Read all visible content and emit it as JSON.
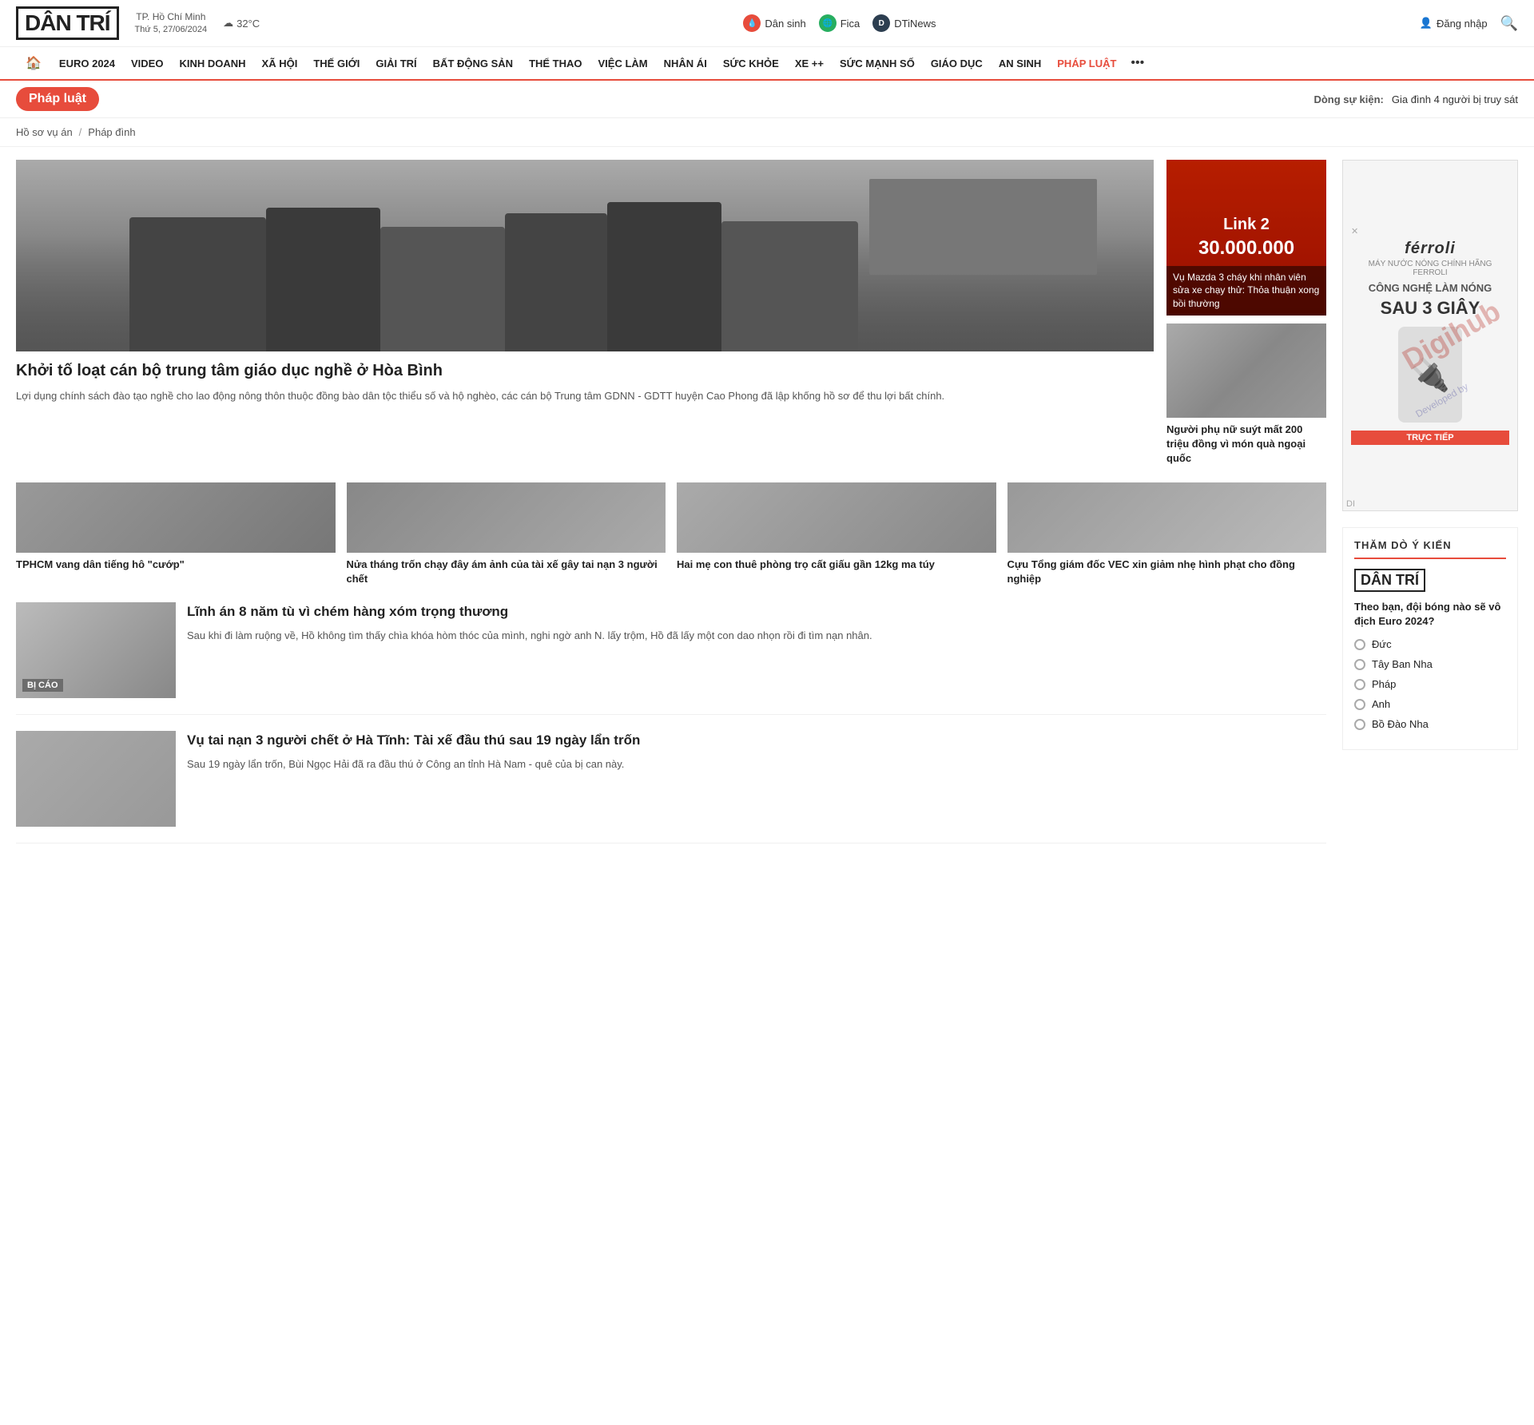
{
  "header": {
    "logo": "DÂN TRÍ",
    "location": "TP. Hồ Chí Minh",
    "date": "Thứ 5, 27/06/2024",
    "weather_icon": "☁",
    "temperature": "32°C",
    "channels": [
      {
        "id": "dan-sinh",
        "label": "Dân sinh",
        "icon": "💧",
        "icon_class": "channel-dan-sinh"
      },
      {
        "id": "fica",
        "label": "Fica",
        "icon": "🌐",
        "icon_class": "channel-fica"
      },
      {
        "id": "dtinews",
        "label": "DTiNews",
        "icon": "D",
        "icon_class": "channel-dtinews"
      }
    ],
    "login_label": "Đăng nhập",
    "search_icon": "🔍"
  },
  "nav": {
    "home_icon": "🏠",
    "items": [
      "EURO 2024",
      "VIDEO",
      "KINH DOANH",
      "XÃ HỘI",
      "THẾ GIỚI",
      "GIẢI TRÍ",
      "BẤT ĐỘNG SẢN",
      "THỂ THAO",
      "VIỆC LÀM",
      "NHÂN ÁI",
      "SỨC KHỎE",
      "XE ++",
      "SỨC MẠNH SỐ",
      "GIÁO DỤC",
      "AN SINH",
      "PHÁP LUẬT"
    ],
    "more_icon": "•••"
  },
  "category": {
    "label": "Pháp luật",
    "breaking_label": "Dòng sự kiện:",
    "breaking_text": "Gia đình 4 người bị truy sát"
  },
  "breadcrumb": {
    "items": [
      "Hồ sơ vụ án",
      "Pháp đình"
    ],
    "separator": "/"
  },
  "featured": {
    "main": {
      "title": "Khởi tố loạt cán bộ trung tâm giáo dục nghề ở Hòa Bình",
      "desc": "Lợi dụng chính sách đào tạo nghề cho lao động nông thôn thuộc đồng bào dân tộc thiểu số và hộ nghèo, các cán bộ Trung tâm GDNN - GDTT huyện Cao Phong đã lập khống hồ sơ để thu lợi bất chính."
    },
    "side_top": {
      "link_label": "Link 2",
      "amount": "30.000.000",
      "caption": "Vụ Mazda 3 cháy khi nhân viên sửa xe chạy thử: Thỏa thuận xong bồi thường"
    },
    "side_bottom": {
      "caption": "Người phụ nữ suýt mất 200 triệu đồng vì món quà ngoại quốc"
    }
  },
  "small_articles": [
    {
      "title": "TPHCM vang dân tiếng hô \"cướp\""
    },
    {
      "title": "Nửa tháng trốn chạy đây ám ảnh của tài xế gây tai nạn 3 người chết"
    },
    {
      "title": "Hai mẹ con thuê phòng trọ cất giấu gần 12kg ma túy"
    },
    {
      "title": "Cựu Tổng giám đốc VEC xin giảm nhẹ hình phạt cho đồng nghiệp"
    }
  ],
  "articles": [
    {
      "title": "Lĩnh án 8 năm tù vì chém hàng xóm trọng thương",
      "desc": "Sau khi đi làm ruộng về, Hồ không tìm thấy chìa khóa hòm thóc của mình, nghi ngờ anh N. lấy trộm, Hồ đã lấy một con dao nhọn rồi đi tìm nạn nhân.",
      "tag": "BỊ CÁO"
    },
    {
      "title": "Vụ tai nạn 3 người chết ở Hà Tĩnh: Tài xế đầu thú sau 19 ngày lẩn trốn",
      "desc": "Sau 19 ngày lẩn trốn, Bùi Ngọc Hải đã ra đầu thú ở Công an tỉnh Hà Nam - quê của bị can này."
    }
  ],
  "poll": {
    "section_title": "THĂM DÒ Ý KIẾN",
    "logo": "DÂN TRÍ",
    "question": "Theo bạn, đội bóng nào sẽ vô địch Euro 2024?",
    "options": [
      "Đức",
      "Tây Ban Nha",
      "Pháp",
      "Anh",
      "Bồ Đào Nha"
    ]
  },
  "ad": {
    "brand": "férroli",
    "tagline": "CÔNG NGHỆ LÀM NÓNG",
    "headline": "SAU 3 GIÂY",
    "sub_label": "MÁY NƯỚC NÓNG CHÍNH HÃNG FERROLI",
    "live_label": "TRỰC TIẾP",
    "di_label": "DI",
    "watermark": "Digihub",
    "watermark_sub": "Developed by"
  }
}
